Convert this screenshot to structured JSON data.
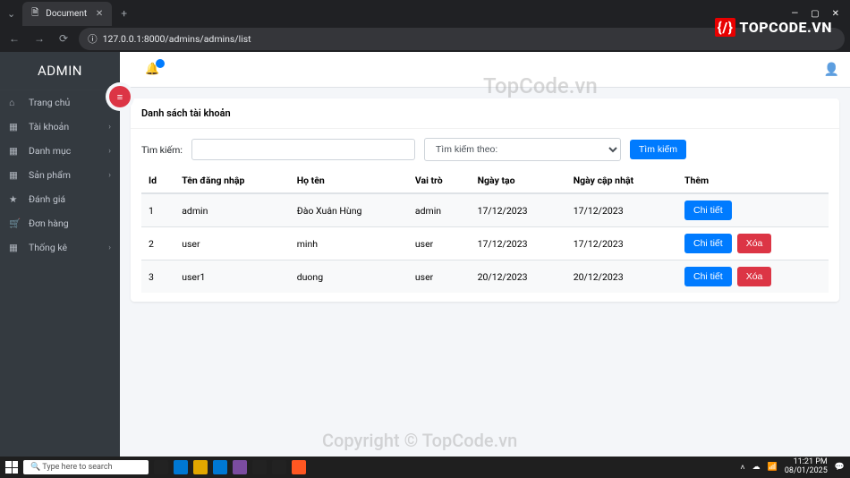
{
  "browser": {
    "tab_title": "Document",
    "url": "127.0.0.1:8000/admins/admins/list"
  },
  "brand_overlay": "TOPCODE.VN",
  "sidebar": {
    "brand": "ADMIN",
    "items": [
      {
        "icon": "⌂",
        "label": "Trang chủ",
        "expandable": false
      },
      {
        "icon": "▦",
        "label": "Tài khoản",
        "expandable": true
      },
      {
        "icon": "▦",
        "label": "Danh mục",
        "expandable": true
      },
      {
        "icon": "▦",
        "label": "Sản phẩm",
        "expandable": true
      },
      {
        "icon": "★",
        "label": "Đánh giá",
        "expandable": false
      },
      {
        "icon": "🛒",
        "label": "Đơn hàng",
        "expandable": false
      },
      {
        "icon": "▦",
        "label": "Thống kê",
        "expandable": true
      }
    ]
  },
  "card_title": "Danh sách tài khoản",
  "search": {
    "label": "Tìm kiếm:",
    "placeholder": "",
    "select_placeholder": "Tìm kiếm theo:",
    "button": "Tìm kiếm"
  },
  "table": {
    "headers": [
      "Id",
      "Tên đăng nhập",
      "Họ tên",
      "Vai trò",
      "Ngày tạo",
      "Ngày cập nhật",
      "Thêm"
    ],
    "rows": [
      {
        "id": "1",
        "username": "admin",
        "fullname": "Đào Xuân Hùng",
        "role": "admin",
        "created": "17/12/2023",
        "updated": "17/12/2023",
        "can_delete": false
      },
      {
        "id": "2",
        "username": "user",
        "fullname": "minh",
        "role": "user",
        "created": "17/12/2023",
        "updated": "17/12/2023",
        "can_delete": true
      },
      {
        "id": "3",
        "username": "user1",
        "fullname": "duong",
        "role": "user",
        "created": "20/12/2023",
        "updated": "20/12/2023",
        "can_delete": true
      }
    ],
    "detail_btn": "Chi tiết",
    "delete_btn": "Xóa"
  },
  "watermarks": {
    "w1": "TopCode.vn",
    "w2": "Copyright © TopCode.vn"
  },
  "taskbar": {
    "search_placeholder": "Type here to search",
    "time": "11:21 PM",
    "date": "08/01/2025"
  }
}
